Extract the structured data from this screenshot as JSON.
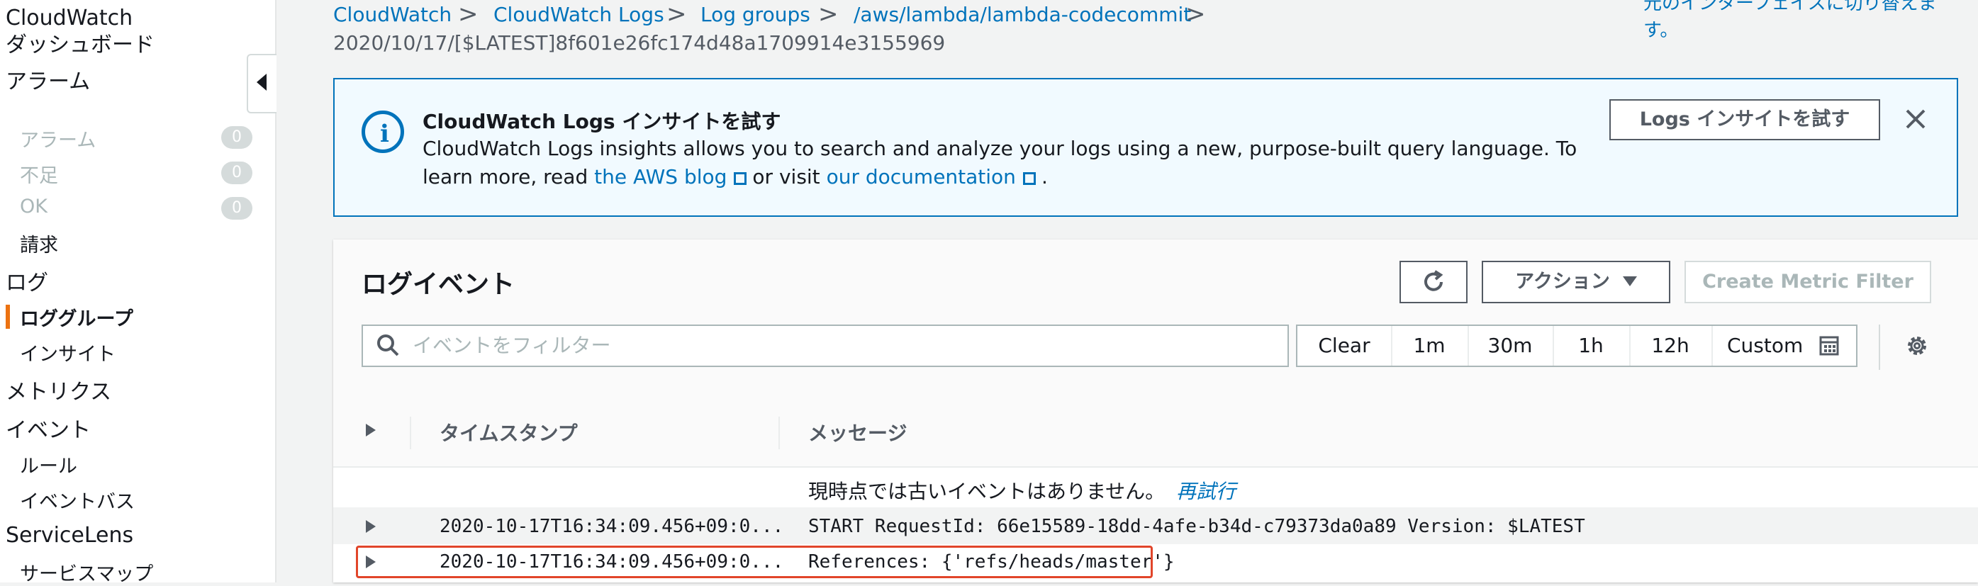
{
  "sidebar": {
    "cloudwatch": "CloudWatch",
    "dashboard": "ダッシュボード",
    "alarms": "アラーム",
    "alarm_items": [
      {
        "label": "アラーム",
        "count": "0"
      },
      {
        "label": "不足",
        "count": "0"
      },
      {
        "label": "OK",
        "count": "0"
      }
    ],
    "billing": "請求",
    "logs": "ログ",
    "log_groups": "ロググループ",
    "insights": "インサイト",
    "metrics": "メトリクス",
    "events": "イベント",
    "rules": "ルール",
    "event_bus": "イベントバス",
    "servicelens": "ServiceLens",
    "service_map": "サービスマップ"
  },
  "breadcrumb": {
    "items": [
      "CloudWatch",
      "CloudWatch Logs",
      "Log groups",
      "/aws/lambda/lambda-codecommit"
    ],
    "separator": ">",
    "leaf": "2020/10/17/[$LATEST]8f601e26fc174d48a1709914e3155969"
  },
  "top_right_link": "元のインターフェイスに切り替えます。",
  "banner": {
    "title": "CloudWatch Logs インサイトを試す",
    "body_prefix": "CloudWatch Logs insights allows you to search and analyze your logs using a new, purpose-built query language. To learn more, read",
    "link1": "the AWS blog",
    "middle": "or visit",
    "link2": "our documentation",
    "suffix": ".",
    "try_button": "Logs インサイトを試す"
  },
  "panel": {
    "title": "ログイベント",
    "action_label": "アクション",
    "metric_filter_label": "Create Metric Filter",
    "search_placeholder": "イベントをフィルター",
    "ranges": [
      "Clear",
      "1m",
      "30m",
      "1h",
      "12h",
      "Custom"
    ]
  },
  "table": {
    "col_timestamp": "タイムスタンプ",
    "col_message": "メッセージ",
    "no_older": "現時点では古いイベントはありません。",
    "retry": "再試行",
    "rows": [
      {
        "timestamp": "2020-10-17T16:34:09.456+09:0...",
        "message": "START RequestId: 66e15589-18dd-4afe-b34d-c79373da0a89 Version: $LATEST"
      },
      {
        "timestamp": "2020-10-17T16:34:09.456+09:0...",
        "message": "References: {'refs/heads/master'}"
      }
    ]
  },
  "colors": {
    "link": "#0073bb",
    "active_accent": "#ec7211",
    "highlight": "#e1452a"
  }
}
